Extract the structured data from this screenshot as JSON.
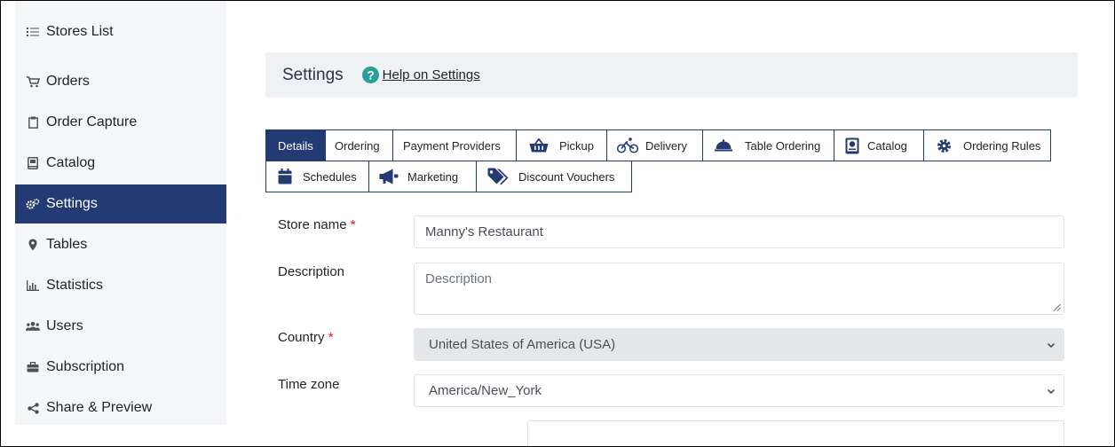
{
  "sidebar": {
    "items": [
      {
        "label": "Stores List",
        "icon": "list-icon"
      },
      {
        "label": "Orders",
        "icon": "cart-icon"
      },
      {
        "label": "Order Capture",
        "icon": "clipboard-icon"
      },
      {
        "label": "Catalog",
        "icon": "book-icon"
      },
      {
        "label": "Settings",
        "icon": "cogs-icon",
        "active": true
      },
      {
        "label": "Tables",
        "icon": "map-marker-icon"
      },
      {
        "label": "Statistics",
        "icon": "chart-icon"
      },
      {
        "label": "Users",
        "icon": "users-icon"
      },
      {
        "label": "Subscription",
        "icon": "briefcase-icon"
      },
      {
        "label": "Share & Preview",
        "icon": "share-icon"
      }
    ]
  },
  "header": {
    "title": "Settings",
    "help_link": "Help on Settings"
  },
  "tabs": {
    "row1": [
      {
        "label": "Details",
        "active": true
      },
      {
        "label": "Ordering"
      },
      {
        "label": "Payment Providers"
      },
      {
        "label": "Pickup",
        "icon": "basket-icon"
      },
      {
        "label": "Delivery",
        "icon": "bicycle-icon"
      },
      {
        "label": "Table Ordering",
        "icon": "cloche-icon"
      },
      {
        "label": "Catalog",
        "icon": "book-icon"
      },
      {
        "label": "Ordering Rules",
        "icon": "gear-icon"
      }
    ],
    "row2": [
      {
        "label": "Schedules",
        "icon": "calendar-icon"
      },
      {
        "label": "Marketing",
        "icon": "megaphone-icon"
      },
      {
        "label": "Discount Vouchers",
        "icon": "tags-icon"
      }
    ]
  },
  "form": {
    "store_name": {
      "label": "Store name",
      "required": "*",
      "value": "Manny's Restaurant"
    },
    "description": {
      "label": "Description",
      "placeholder": "Description"
    },
    "country": {
      "label": "Country",
      "required": "*",
      "value": "United States of America (USA)"
    },
    "time_zone": {
      "label": "Time zone",
      "value": "America/New_York"
    }
  },
  "colors": {
    "primary": "#233a73",
    "required": "#d0191a",
    "help_icon": "#2aa198"
  }
}
